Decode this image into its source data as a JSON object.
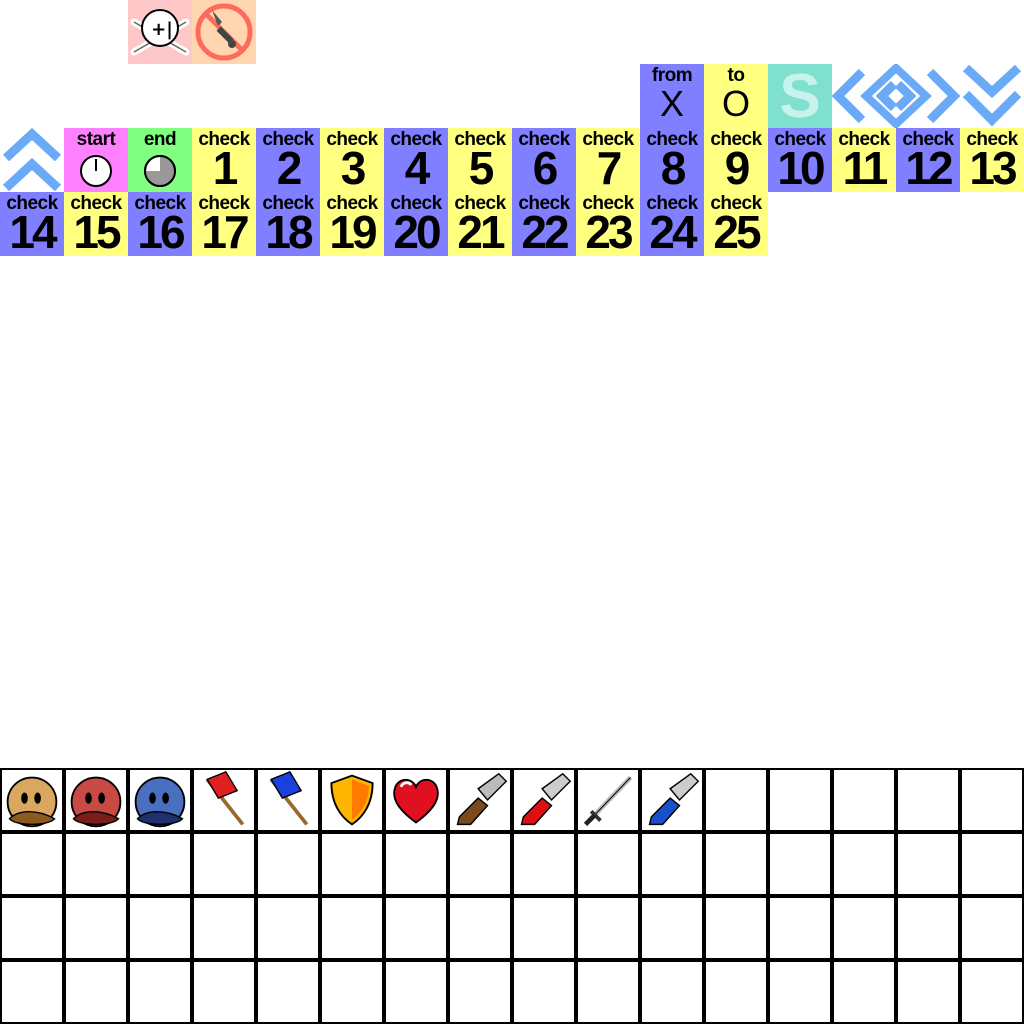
{
  "colors": {
    "purple": "#7f7fff",
    "yellow": "#ffff80",
    "pink": "#ff80ff",
    "green": "#80ff80",
    "teal": "#80e0d0",
    "arrow_blue": "#6aaaf6",
    "skull_bg": "#ffc8c8",
    "noknife_bg": "#ffd6b0"
  },
  "special_tiles": {
    "start": {
      "label": "start",
      "icon": "clock-start-icon"
    },
    "end": {
      "label": "end",
      "icon": "clock-end-icon"
    },
    "from": {
      "label": "from",
      "glyph": "X"
    },
    "to": {
      "label": "to",
      "glyph": "O"
    },
    "s_tile": {
      "glyph": "S"
    },
    "skull": {
      "icon": "skull-crossbones-icon"
    },
    "no_knife": {
      "icon": "no-knife-icon"
    },
    "arrows": [
      "double-up-arrow-icon",
      "left-arrow-icon",
      "diamond-arrow-icon",
      "right-arrow-icon",
      "double-down-arrow-icon"
    ]
  },
  "checkpoints": [
    {
      "label": "check",
      "number": "1"
    },
    {
      "label": "check",
      "number": "2"
    },
    {
      "label": "check",
      "number": "3"
    },
    {
      "label": "check",
      "number": "4"
    },
    {
      "label": "check",
      "number": "5"
    },
    {
      "label": "check",
      "number": "6"
    },
    {
      "label": "check",
      "number": "7"
    },
    {
      "label": "check",
      "number": "8"
    },
    {
      "label": "check",
      "number": "9"
    },
    {
      "label": "check",
      "number": "10"
    },
    {
      "label": "check",
      "number": "11"
    },
    {
      "label": "check",
      "number": "12"
    },
    {
      "label": "check",
      "number": "13"
    },
    {
      "label": "check",
      "number": "14"
    },
    {
      "label": "check",
      "number": "15"
    },
    {
      "label": "check",
      "number": "16"
    },
    {
      "label": "check",
      "number": "17"
    },
    {
      "label": "check",
      "number": "18"
    },
    {
      "label": "check",
      "number": "19"
    },
    {
      "label": "check",
      "number": "20"
    },
    {
      "label": "check",
      "number": "21"
    },
    {
      "label": "check",
      "number": "22"
    },
    {
      "label": "check",
      "number": "23"
    },
    {
      "label": "check",
      "number": "24"
    },
    {
      "label": "check",
      "number": "25"
    }
  ],
  "inventory": {
    "rows": 4,
    "columns": 16,
    "items": [
      "tan-blob-character-icon",
      "red-blob-character-icon",
      "blue-blob-character-icon",
      "red-flag-icon",
      "blue-flag-icon",
      "shield-icon",
      "heart-icon",
      "rifle-icon",
      "red-blaster-icon",
      "sword-icon",
      "blue-blaster-icon"
    ]
  }
}
